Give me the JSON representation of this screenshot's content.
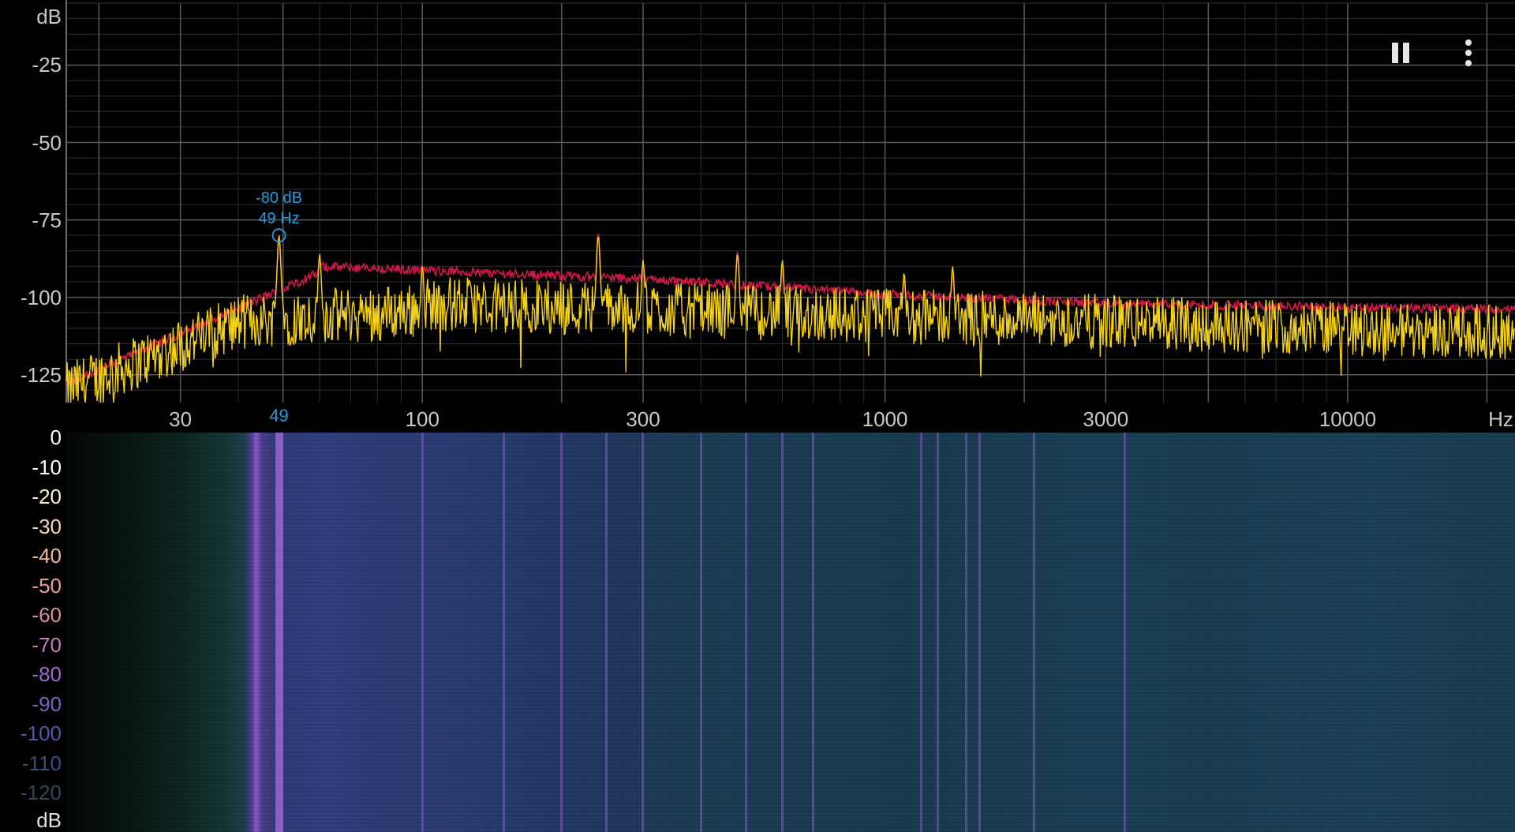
{
  "spectrum": {
    "y_unit": "dB",
    "y_ticks": [
      "-25",
      "-50",
      "-75",
      "-100",
      "-125"
    ],
    "y_tick_values": [
      -25,
      -50,
      -75,
      -100,
      -125
    ],
    "y_range": [
      -5,
      -134
    ],
    "x_unit": "Hz",
    "x_range_hz": [
      17,
      23000
    ],
    "x_ticks": [
      "30",
      "100",
      "300",
      "1000",
      "3000",
      "10000"
    ],
    "x_tick_values": [
      30,
      100,
      300,
      1000,
      3000,
      10000
    ],
    "peak_marker": {
      "db_label": "-80 dB",
      "hz_label": "49 Hz",
      "axis_label": "49",
      "freq_hz": 49,
      "db": -80
    },
    "colors": {
      "grid": "#5a5a5a",
      "grid_minor": "#2e2e2e",
      "peak_hold_line": "#d01848",
      "live_line": "#f5d21a",
      "marker": "#1e9ee6"
    }
  },
  "spectrogram": {
    "scale_labels": [
      "0",
      "-10",
      "-20",
      "-30",
      "-40",
      "-50",
      "-60",
      "-70",
      "-80",
      "-90",
      "-100",
      "-110",
      "-120"
    ],
    "scale_colors": [
      "#ffffff",
      "#ffffff",
      "#fdf0d0",
      "#f6d8b0",
      "#efb89a",
      "#e5a090",
      "#d98ca0",
      "#c47cb4",
      "#9c6cc8",
      "#7462c2",
      "#4e5aa8",
      "#34507e",
      "#2a4a5a"
    ],
    "bottom_unit": "dB",
    "streak_freqs_hz": [
      49,
      100,
      150,
      200,
      250,
      300,
      400,
      500,
      600,
      700,
      1200,
      1300,
      1500,
      1600,
      2100,
      3300
    ],
    "streak_color": "#9a66d6"
  },
  "toolbar": {
    "pause_icon": "pause-icon",
    "menu_icon": "more-vertical-icon"
  }
}
